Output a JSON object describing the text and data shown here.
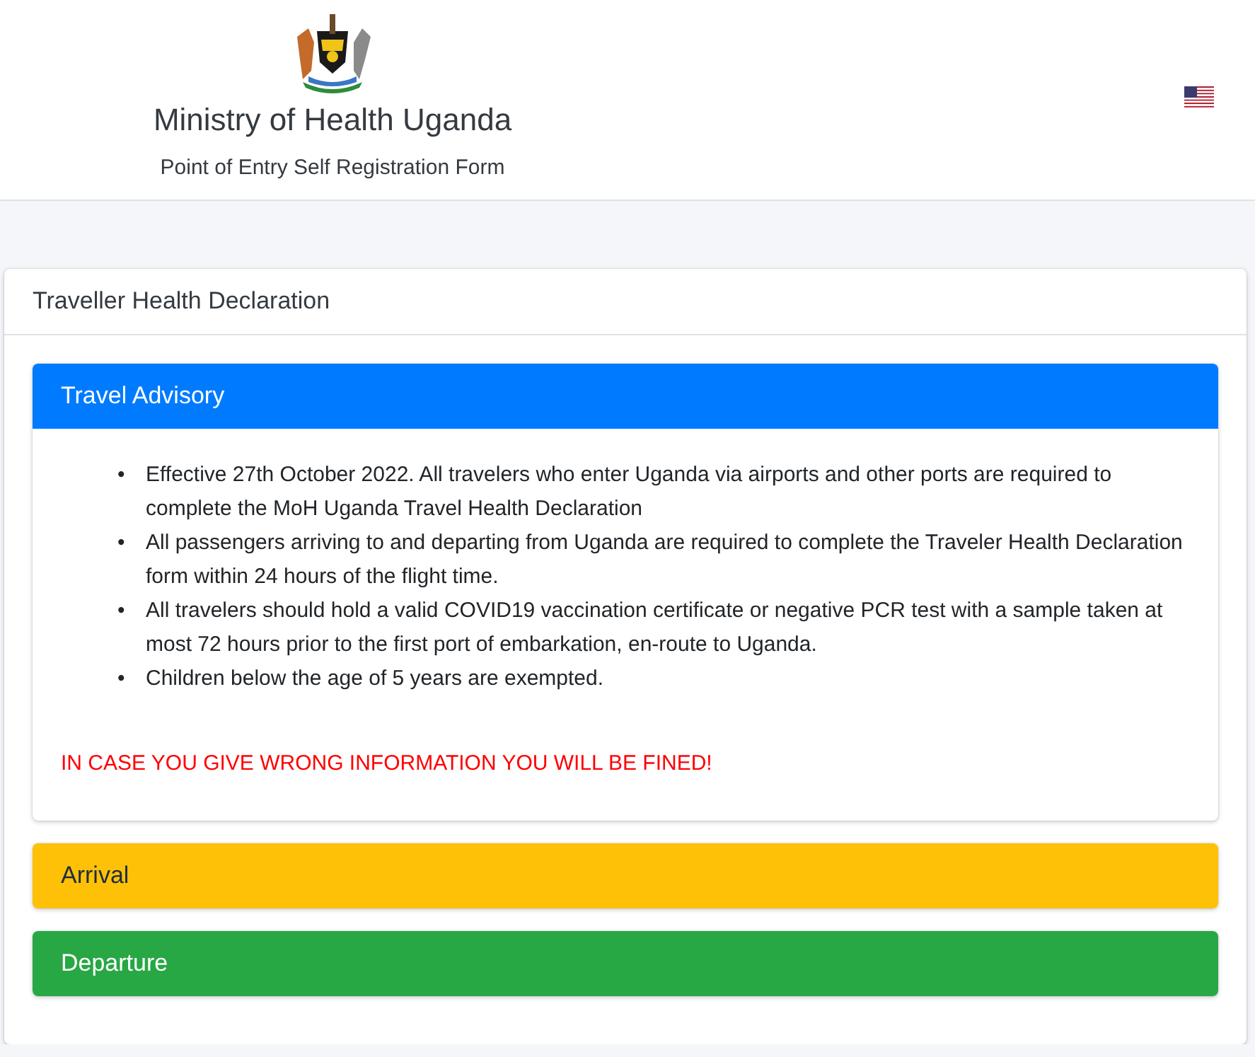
{
  "header": {
    "title": "Ministry of Health Uganda",
    "subtitle": "Point of Entry Self Registration Form"
  },
  "card": {
    "title": "Traveller Health Declaration"
  },
  "panels": [
    {
      "title": "Travel Advisory",
      "color": "#007bff",
      "expanded": true,
      "items": [
        {
          "bullet": "•",
          "text": "Effective 27th October 2022. All travelers who enter Uganda via airports and other ports are required to complete the MoH Uganda Travel Health Declaration"
        },
        {
          "bullet": "•",
          "text": "All passengers arriving to and departing from Uganda are required to complete the Traveler Health Declaration form within 24 hours of the flight time."
        },
        {
          "bullet": "•",
          "text": "All travelers should hold a valid COVID19 vaccination certificate or negative PCR test with a sample taken at most 72 hours prior to the first port of embarkation, en-route to Uganda."
        },
        {
          "bullet": "•",
          "text": "Children below the age of 5 years are exempted."
        }
      ],
      "warning": "IN CASE YOU GIVE WRONG INFORMATION YOU WILL BE FINED!"
    },
    {
      "title": "Arrival",
      "color": "#ffc107",
      "expanded": false
    },
    {
      "title": "Departure",
      "color": "#28a745",
      "expanded": false
    }
  ]
}
